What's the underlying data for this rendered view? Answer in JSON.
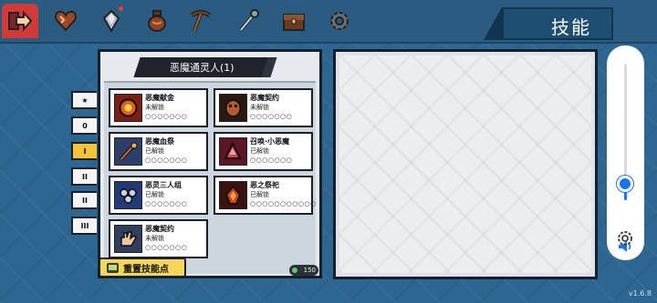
{
  "top_nav": {
    "tabs": [
      {
        "icon": "exit-arrow-icon",
        "active": true
      },
      {
        "icon": "heart-icon"
      },
      {
        "icon": "gem-icon",
        "badge": true
      },
      {
        "icon": "pouch-icon"
      },
      {
        "icon": "pickaxe-icon"
      },
      {
        "icon": "wand-icon"
      },
      {
        "icon": "chest-icon"
      },
      {
        "icon": "gear-icon"
      }
    ],
    "title": "技能"
  },
  "skill_list": {
    "header": "恶魔通灵人(1)",
    "level_tabs": [
      "★",
      "0",
      "I",
      "II",
      "II",
      "III"
    ],
    "active_level_index": 2,
    "cards": [
      {
        "name": "恶魔献金",
        "status": "未解锁",
        "pips": "○○○○○○○"
      },
      {
        "name": "恶魔契约",
        "status": "未解锁",
        "pips": "○○○○○○○"
      },
      {
        "name": "恶魔血祭",
        "status": "已解锁",
        "pips": "○○○○○○○"
      },
      {
        "name": "召唤·小恶魔",
        "status": "已解锁",
        "pips": "○○○○○○○"
      },
      {
        "name": "恶灵三人组",
        "status": "已解锁",
        "pips": "○○○○○○○"
      },
      {
        "name": "恶之祭祀",
        "status": "已解锁",
        "pips": "○○○○○○○○○○○"
      },
      {
        "name": "恶魔契约",
        "status": "未解锁",
        "pips": "○○○○○○○"
      }
    ]
  },
  "reset_button": {
    "label": "重置技能点"
  },
  "skill_points": {
    "value": "150"
  },
  "volume": {
    "level": 0.12
  },
  "version": "v1.6.8",
  "colors": {
    "accent": "#d23a3a",
    "highlight": "#f2c43a",
    "volume": "#1a73e8"
  }
}
